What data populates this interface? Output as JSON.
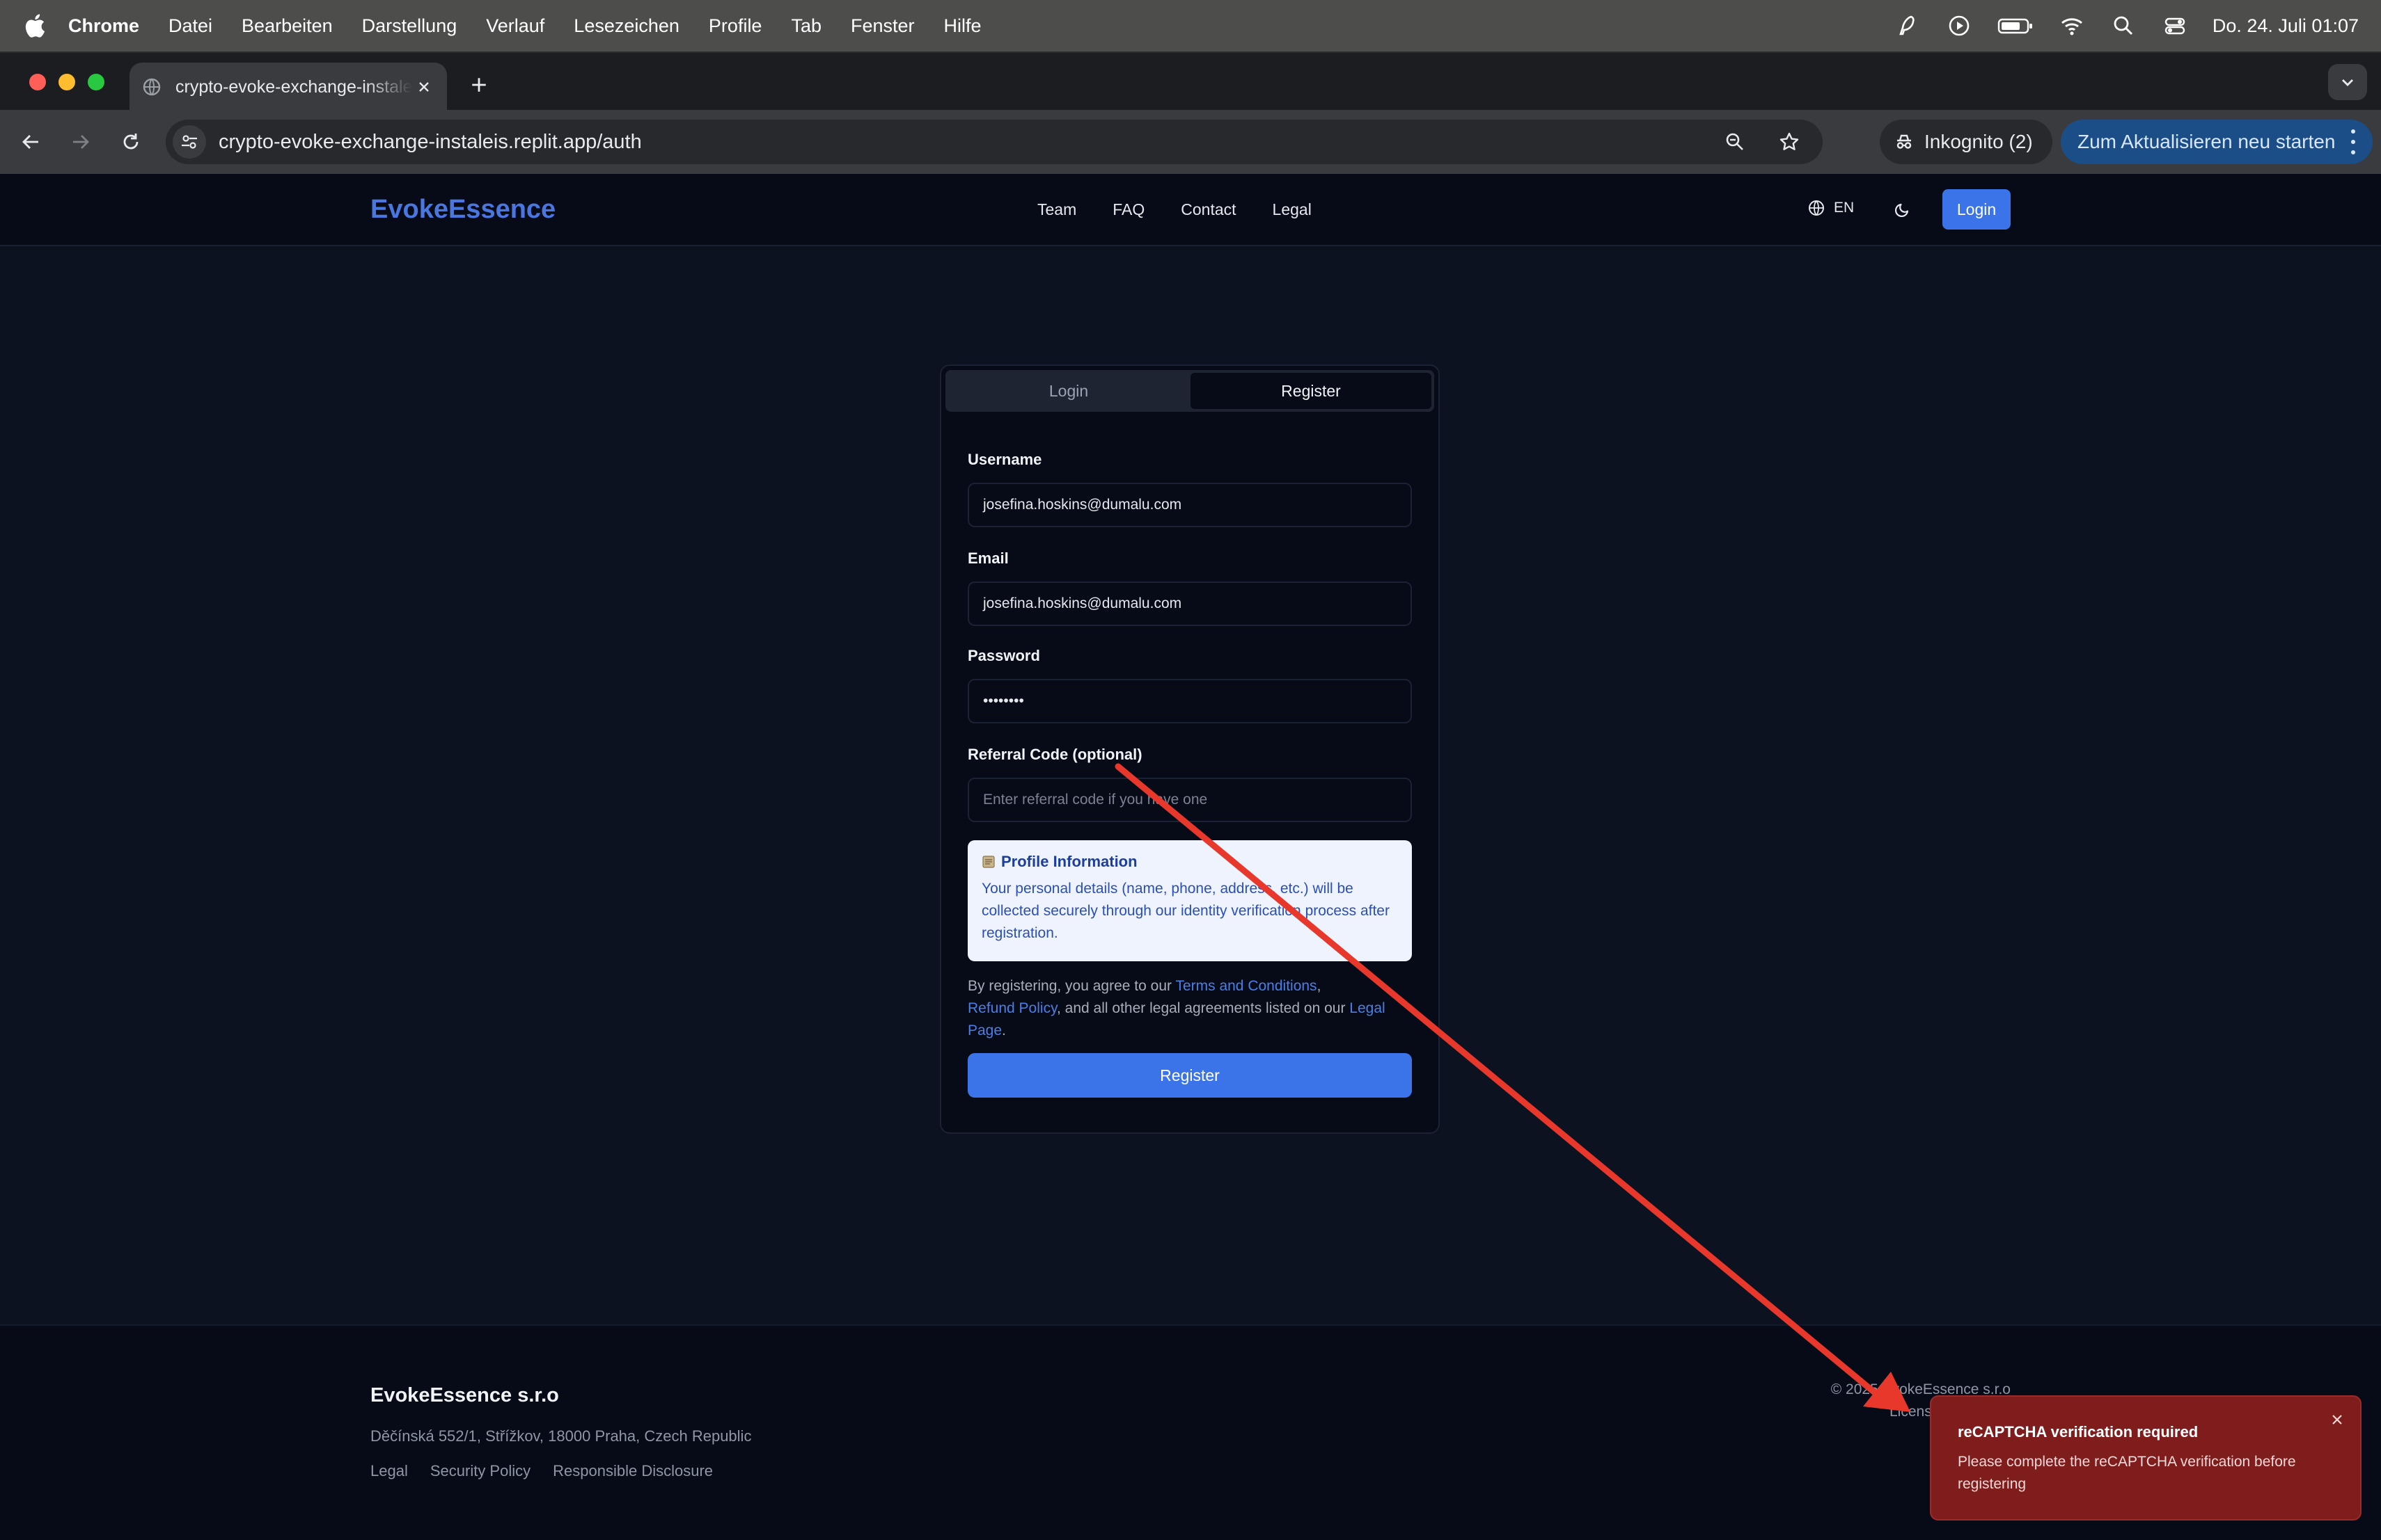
{
  "menubar": {
    "app": "Chrome",
    "items": [
      "Datei",
      "Bearbeiten",
      "Darstellung",
      "Verlauf",
      "Lesezeichen",
      "Profile",
      "Tab",
      "Fenster",
      "Hilfe"
    ],
    "clock": "Do. 24. Juli  01:07"
  },
  "browser": {
    "tab_title": "crypto-evoke-exchange-instaleis.replit.app/auth",
    "url": "crypto-evoke-exchange-instaleis.replit.app/auth",
    "incognito": "Inkognito (2)",
    "update_button": "Zum Aktualisieren neu starten"
  },
  "site": {
    "brand": "EvokeEssence",
    "nav": [
      "Team",
      "FAQ",
      "Contact",
      "Legal"
    ],
    "language": "EN",
    "login_button": "Login"
  },
  "auth": {
    "tabs": {
      "login": "Login",
      "register": "Register"
    },
    "username": {
      "label": "Username",
      "value": "josefina.hoskins@dumalu.com"
    },
    "email": {
      "label": "Email",
      "value": "josefina.hoskins@dumalu.com"
    },
    "password": {
      "label": "Password",
      "value": "••••••••"
    },
    "referral": {
      "label": "Referral Code (optional)",
      "placeholder": "Enter referral code if you have one"
    },
    "info": {
      "title": "Profile Information",
      "body": "Your personal details (name, phone, address, etc.) will be collected securely through our identity verification process after registration."
    },
    "agreement": {
      "prefix": "By registering, you agree to our ",
      "terms": "Terms and Conditions",
      "comma": ",",
      "refund": "Refund Policy",
      "middle": ", and all other legal agreements listed on our ",
      "legal": "Legal Page",
      "suffix": "."
    },
    "submit": "Register"
  },
  "footer": {
    "company": "EvokeEssence s.r.o",
    "address": "Děčínská 552/1, Střížkov, 18000 Praha, Czech Republic",
    "links": [
      "Legal",
      "Security Policy",
      "Responsible Disclosure"
    ],
    "copyright": "© 2025 EvokeEssence s.r.o",
    "license": "Licens"
  },
  "toast": {
    "title": "reCAPTCHA verification required",
    "message": "Please complete the reCAPTCHA verification before registering"
  },
  "colors": {
    "accent": "#3b73e8",
    "brand": "#4a76e0",
    "toast_bg": "#7f1d1d",
    "annotation_arrow": "#e8382b"
  }
}
